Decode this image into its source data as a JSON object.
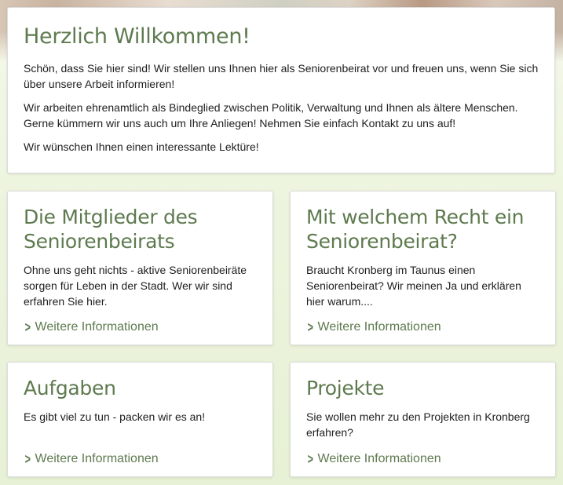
{
  "intro": {
    "title": "Herzlich Willkommen!",
    "paragraphs": [
      "Schön, dass Sie hier sind! Wir stellen uns Ihnen hier als Seniorenbeirat vor und freuen uns, wenn Sie sich über unsere Arbeit informieren!",
      "Wir arbeiten ehrenamtlich als Bindeglied zwischen Politik, Verwaltung und Ihnen als ältere Menschen. Gerne kümmern wir uns auch um Ihre Anliegen! Nehmen Sie einfach Kontakt zu uns auf!",
      "Wir wünschen Ihnen einen interessante Lektüre!"
    ]
  },
  "cards": [
    {
      "title": "Die Mitglieder des Seniorenbeirats",
      "text": "Ohne uns geht nichts - aktive Seniorenbeiräte sorgen für Leben in der Stadt. Wer wir sind erfahren Sie hier.",
      "link": "Weitere Informationen"
    },
    {
      "title": "Mit welchem Recht ein Seniorenbeirat?",
      "text": "Braucht Kronberg im Taunus einen Seniorenbeirat? Wir meinen Ja und erklären hier warum....",
      "link": "Weitere Informationen"
    },
    {
      "title": "Aufgaben",
      "text": "Es gibt viel zu tun - packen wir es an!",
      "link": "Weitere Informationen"
    },
    {
      "title": "Projekte",
      "text": "Sie wollen mehr zu den Projekten in Kronberg erfahren?",
      "link": "Weitere Informationen"
    }
  ],
  "icons": {
    "link_chevron": "chevron-right-icon"
  },
  "colors": {
    "heading_green": "#5e7a4f",
    "background": "#eef5e0",
    "card": "#ffffff"
  }
}
